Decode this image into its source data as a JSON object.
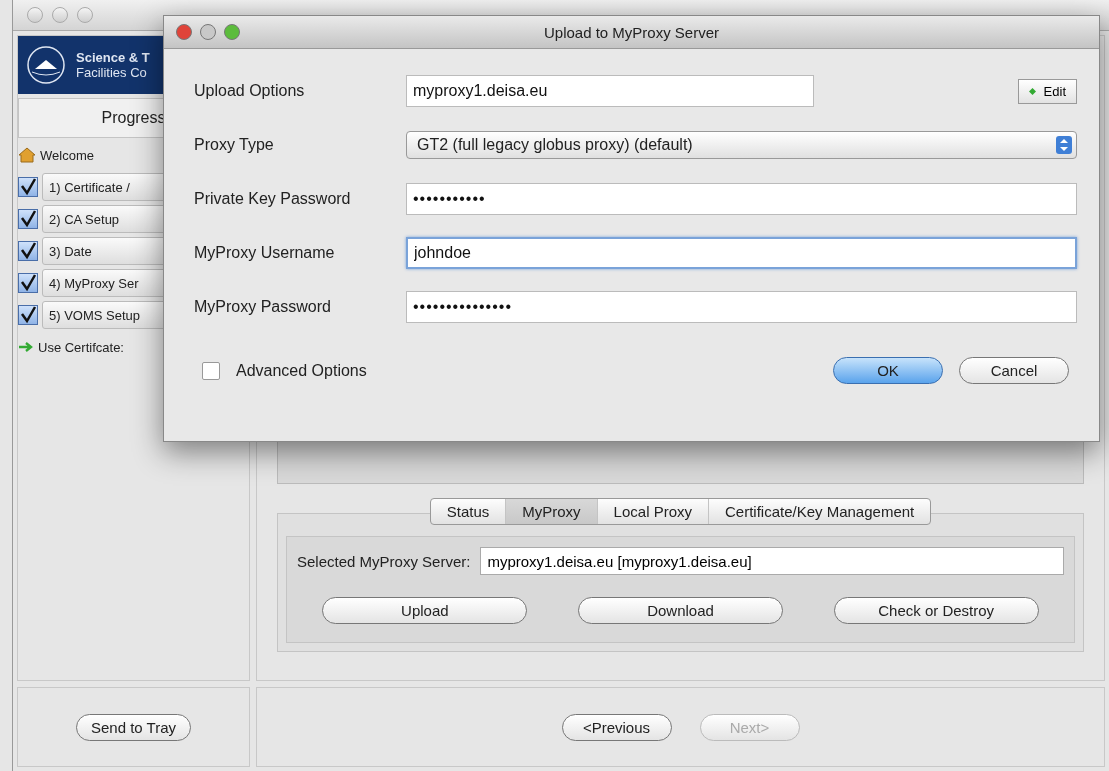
{
  "main_window": {
    "logo": {
      "line_1": "Science & T",
      "line_2": "Facilities Co"
    },
    "progress": {
      "title": "Progress",
      "items": [
        {
          "kind": "home",
          "label": "Welcome"
        },
        {
          "kind": "check",
          "label": "1) Certificate /",
          "checked": true
        },
        {
          "kind": "check",
          "label": "2) CA Setup",
          "checked": true
        },
        {
          "kind": "check",
          "label": "3) Date",
          "checked": true
        },
        {
          "kind": "check",
          "label": "4) MyProxy Ser",
          "checked": true
        },
        {
          "kind": "check",
          "label": "5) VOMS Setup",
          "checked": true
        },
        {
          "kind": "arrow",
          "label": "Use Certifcate:"
        }
      ]
    },
    "tabs": [
      {
        "label": "Status",
        "selected": false
      },
      {
        "label": "MyProxy",
        "selected": true
      },
      {
        "label": "Local Proxy",
        "selected": false
      },
      {
        "label": "Certificate/Key Management",
        "selected": false
      }
    ],
    "server": {
      "label": "Selected MyProxy Server:",
      "value": "myproxy1.deisa.eu [myproxy1.deisa.eu]"
    },
    "actions": [
      "Upload",
      "Download",
      "Check or Destroy"
    ],
    "send_to_tray": "Send to Tray",
    "nav": [
      {
        "label": "<Previous",
        "disabled": false
      },
      {
        "label": "Next>",
        "disabled": true
      }
    ]
  },
  "dialog": {
    "title": "Upload to MyProxy Server",
    "fields": [
      {
        "kind": "text",
        "label": "Upload Options",
        "value": "myproxy1.deisa.eu",
        "focused": false
      },
      {
        "kind": "select",
        "label": "Proxy Type",
        "value": "GT2 (full legacy globus proxy) (default)",
        "focused": false
      },
      {
        "kind": "password",
        "label": "Private Key Password",
        "value": "•••••••••••",
        "focused": false
      },
      {
        "kind": "text",
        "label": "MyProxy Username",
        "value": "johndoe",
        "focused": true
      },
      {
        "kind": "password",
        "label": "MyProxy Password",
        "value": "•••••••••••••••",
        "focused": false
      }
    ],
    "edit_button": "Edit",
    "advanced": {
      "label": "Advanced Options",
      "checked": false
    },
    "buttons": [
      {
        "label": "OK",
        "default": true
      },
      {
        "label": "Cancel",
        "default": false
      }
    ]
  }
}
